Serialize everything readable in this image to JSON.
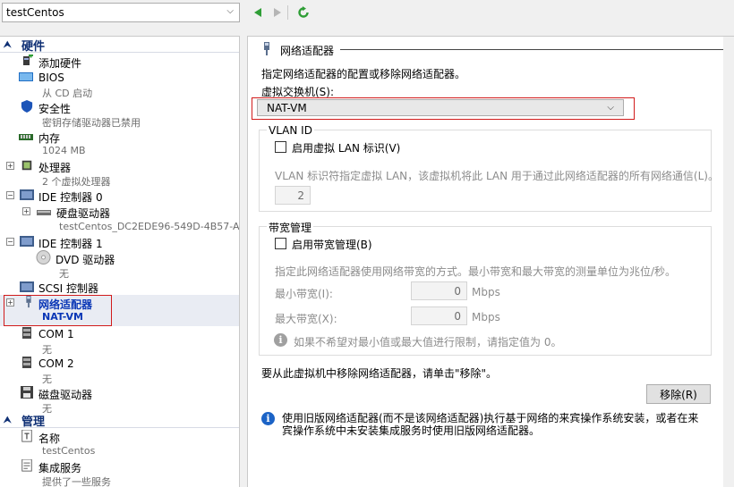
{
  "vm_selector": {
    "value": "testCentos"
  },
  "hardware": {
    "title": "硬件",
    "items": [
      {
        "label": "添加硬件"
      },
      {
        "label": "BIOS",
        "sub": "从 CD 启动"
      },
      {
        "label": "安全性",
        "sub": "密钥存储驱动器已禁用"
      },
      {
        "label": "内存",
        "sub": "1024 MB"
      },
      {
        "label": "处理器",
        "sub": "2 个虚拟处理器"
      },
      {
        "label": "IDE 控制器 0"
      },
      {
        "label": "硬盘驱动器",
        "sub": "testCentos_DC2EDE96-549D-4B57-A4..."
      },
      {
        "label": "IDE 控制器 1"
      },
      {
        "label": "DVD 驱动器",
        "sub": "无"
      },
      {
        "label": "SCSI 控制器"
      },
      {
        "label": "网络适配器",
        "sub": "NAT-VM"
      },
      {
        "label": "COM 1",
        "sub": "无"
      },
      {
        "label": "COM 2",
        "sub": "无"
      },
      {
        "label": "磁盘驱动器",
        "sub": "无"
      }
    ]
  },
  "management": {
    "title": "管理",
    "items": [
      {
        "label": "名称",
        "sub": "testCentos"
      },
      {
        "label": "集成服务",
        "sub": "提供了一些服务"
      }
    ]
  },
  "adapter": {
    "section_title": "网络适配器",
    "description": "指定网络适配器的配置或移除网络适配器。",
    "switch_label": "虚拟交换机(S):",
    "switch_value": "NAT-VM",
    "vlan_title": "VLAN ID",
    "vlan_checkbox": "启用虚拟 LAN 标识(V)",
    "vlan_desc": "VLAN 标识符指定虚拟 LAN，该虚拟机将此 LAN 用于通过此网络适配器的所有网络通信(L)。",
    "vlan_value": "2",
    "bw_title": "带宽管理",
    "bw_checkbox": "启用带宽管理(B)",
    "bw_desc": "指定此网络适配器使用网络带宽的方式。最小带宽和最大带宽的测量单位为兆位/秒。",
    "min_label": "最小带宽(I):",
    "min_value": "0",
    "max_label": "最大带宽(X):",
    "max_value": "0",
    "unit": "Mbps",
    "hint": "如果不希望对最小值或最大值进行限制，请指定值为 0。",
    "remove_desc": "要从此虚拟机中移除网络适配器，请单击\"移除\"。",
    "remove_button": "移除(R)",
    "legacy_info": "使用旧版网络适配器(而不是该网络适配器)执行基于网络的来宾操作系统安装，或者在来宾操作系统中未安装集成服务时使用旧版网络适配器。"
  },
  "colors": {
    "accent": "#0b37b6",
    "highlight_border": "#d11b1b",
    "section_text": "#0e2f74"
  }
}
